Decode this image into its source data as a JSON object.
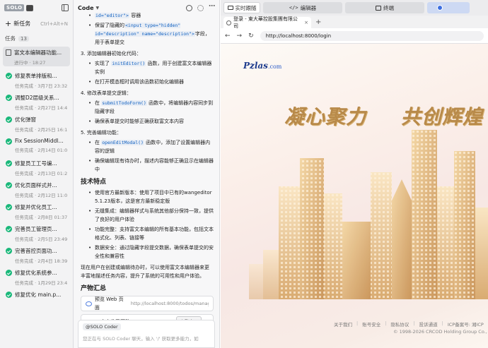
{
  "sidebar": {
    "logo": "SOLO",
    "new_task": "新任务",
    "new_task_shortcut": "Ctrl+Alt+N",
    "tasks_label": "任务",
    "tasks_count": "13",
    "tasks": [
      {
        "title": "富文本编辑器功能...",
        "meta": "进行中 · 18:27",
        "icon": "doc"
      },
      {
        "title": "修复表单排版和...",
        "meta": "任务完成 · 3月7日 23:32",
        "icon": "done"
      },
      {
        "title": "调整D2层级关系...",
        "meta": "任务完成 · 2月27日 14:44",
        "icon": "done"
      },
      {
        "title": "优化弹窗",
        "meta": "任务完成 · 2月25日 16:17",
        "icon": "done"
      },
      {
        "title": "Fix SessionMiddl...",
        "meta": "任务完成 · 2月14日 01:05",
        "icon": "done"
      },
      {
        "title": "修复员工工号编...",
        "meta": "任务完成 · 2月13日 01:23",
        "icon": "done"
      },
      {
        "title": "优化页面样式并...",
        "meta": "任务完成 · 2月12日 11:05",
        "icon": "done"
      },
      {
        "title": "修复并优化员工...",
        "meta": "任务完成 · 2月8日 01:37",
        "icon": "done"
      },
      {
        "title": "完善员工管理页...",
        "meta": "任务完成 · 2月5日 23:49",
        "icon": "done"
      },
      {
        "title": "完善首控页面功...",
        "meta": "任务完成 · 2月4日 18:39",
        "icon": "done"
      },
      {
        "title": "修复优化系统参...",
        "meta": "任务完成 · 1月29日 23:44",
        "icon": "done"
      },
      {
        "title": "修复优化 main.p...",
        "meta": "",
        "icon": "done"
      }
    ]
  },
  "code_panel": {
    "title": "Code",
    "top_line_code": "id=\"editor\">",
    "top_line_suffix": "容器",
    "item_hidden_prefix": "保留了隐藏的",
    "item_hidden_code": "<input type=\"hidden\" id=\"description\" name=\"description\">",
    "item_hidden_suffix": "字段，用于表单提交",
    "step3": "3. 添加编辑器初始化代码：",
    "step3_a_prefix": "实现了",
    "step3_a_code": "initEditor()",
    "step3_a_suffix": "函数，用于创建富文本编辑器实例",
    "step3_b": "在打开模态框时调用该函数初始化编辑器",
    "step4": "4. 修改表单提交逻辑：",
    "step4_a_prefix": "在",
    "step4_a_code": "submitTodoForm()",
    "step4_a_suffix": "函数中，将编辑器内容同步到隐藏字段",
    "step4_b": "确保表单提交时能够正确获取富文本内容",
    "step5": "5. 完善编辑功能：",
    "step5_a_prefix": "在",
    "step5_a_code": "openEditModal()",
    "step5_a_suffix": "函数中，添加了设置编辑器内容的逻辑",
    "step5_b": "确保编辑现有待办时，描述内容能够正确显示在编辑器中",
    "tech_heading": "技术特点",
    "tech_items": [
      "使用官方最新版本：使用了项目中已有的wangeditor 5.1.23版本，这是官方最新稳定版",
      "无缝集成：编辑器样式与系统其他部分保持一致，提供了良好的用户体验",
      "功能完整：支持富文本编辑的所有基本功能，包括文本格式化、列表、链接等",
      "数据安全：通过隐藏字段提交数据，确保表单提交的安全性和兼容性"
    ],
    "summary": "现在用户在创建或编辑待办时，可以使用富文本编辑器来更丰富地描述任务内容，提升了系统的可用性和用户体验。",
    "artifacts_heading": "产物汇总",
    "preview_label": "预览 Web 页面",
    "preview_url": "http://localhost:8000/todos/manage",
    "files_changed": "1个文件已更改",
    "added": "+31",
    "removed": "-2",
    "review_button": "查看变更",
    "mention": "@SOLO Coder",
    "input_placeholder": "您正在与 SOLO Coder 聊天，输入 '/' 获取更多能力，如"
  },
  "top_tabs": {
    "tab1": "实时跟随",
    "tab2": "编辑器",
    "tab3": "终端"
  },
  "browser": {
    "tab_title": "登录 - 東大華控股集團有限公司",
    "url": "http://localhost:8000/login",
    "brand": "Pzlas",
    "brand_suffix": ".com",
    "slogan_left": "凝心聚力",
    "slogan_right": "共创辉煌",
    "footer_links": [
      "关于我们",
      "账号安全",
      "隐私协议",
      "投诉通道",
      "ICP备案号: 湘ICP"
    ],
    "copyright": "© 1998-2026 CRCOD Holding Group Co., L"
  },
  "colors": {
    "accent_green": "#19b87a",
    "accent_blue": "#3c6ee0",
    "gold": "#b88a4a"
  }
}
